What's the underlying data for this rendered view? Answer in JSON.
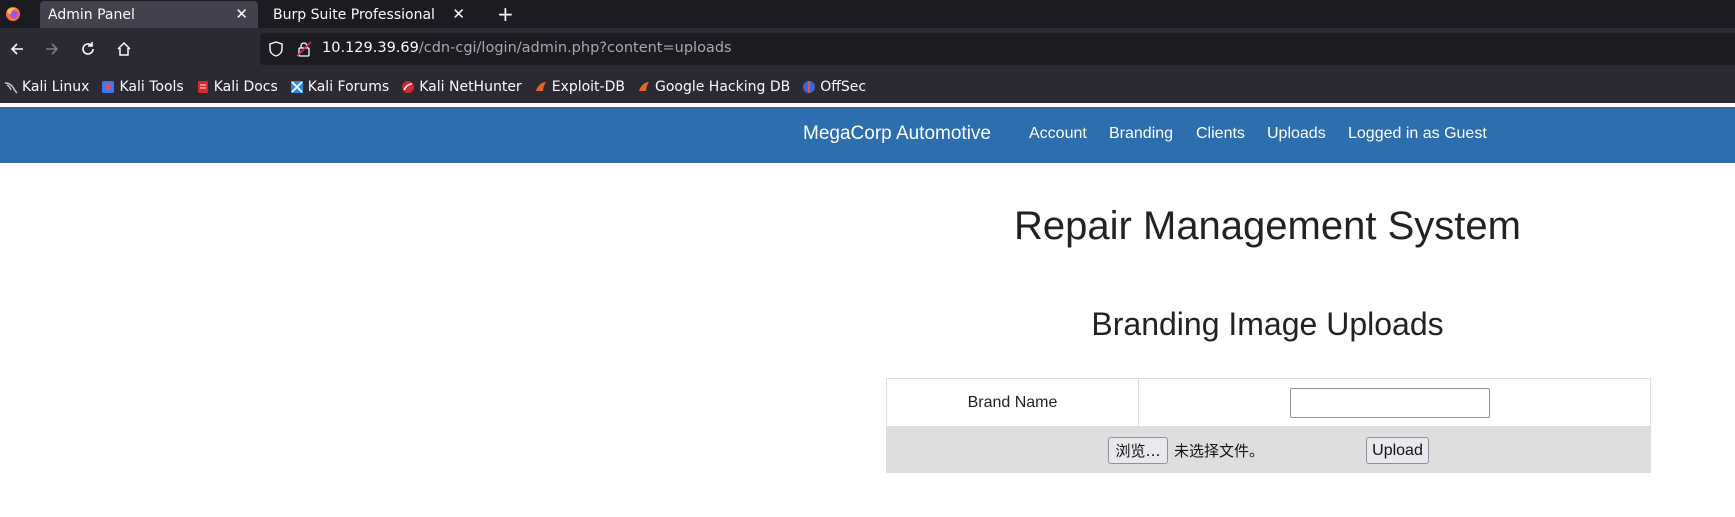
{
  "browser": {
    "tabs": [
      {
        "label": "Admin Panel",
        "active": true
      },
      {
        "label": "Burp Suite Professional",
        "active": false
      }
    ],
    "url": {
      "host": "10.129.39.69",
      "path": "/cdn-cgi/login/admin.php?content=uploads"
    },
    "bookmarks": [
      {
        "label": "Kali Linux",
        "icon": "kali-dragon-icon"
      },
      {
        "label": "Kali Tools",
        "icon": "kali-tools-icon"
      },
      {
        "label": "Kali Docs",
        "icon": "kali-docs-icon"
      },
      {
        "label": "Kali Forums",
        "icon": "kali-forums-icon"
      },
      {
        "label": "Kali NetHunter",
        "icon": "nethunter-icon"
      },
      {
        "label": "Exploit-DB",
        "icon": "exploit-db-icon"
      },
      {
        "label": "Google Hacking DB",
        "icon": "ghdb-icon"
      },
      {
        "label": "OffSec",
        "icon": "offsec-icon"
      }
    ]
  },
  "site": {
    "brand": "MegaCorp Automotive",
    "nav": [
      "Account",
      "Branding",
      "Clients",
      "Uploads",
      "Logged in as Guest"
    ],
    "header_color": "#2c6eae"
  },
  "main": {
    "title": "Repair Management System",
    "section_title": "Branding Image Uploads",
    "form": {
      "brand_label": "Brand Name",
      "brand_value": "",
      "browse_label": "浏览…",
      "file_status": "未选择文件。",
      "upload_label": "Upload"
    }
  }
}
